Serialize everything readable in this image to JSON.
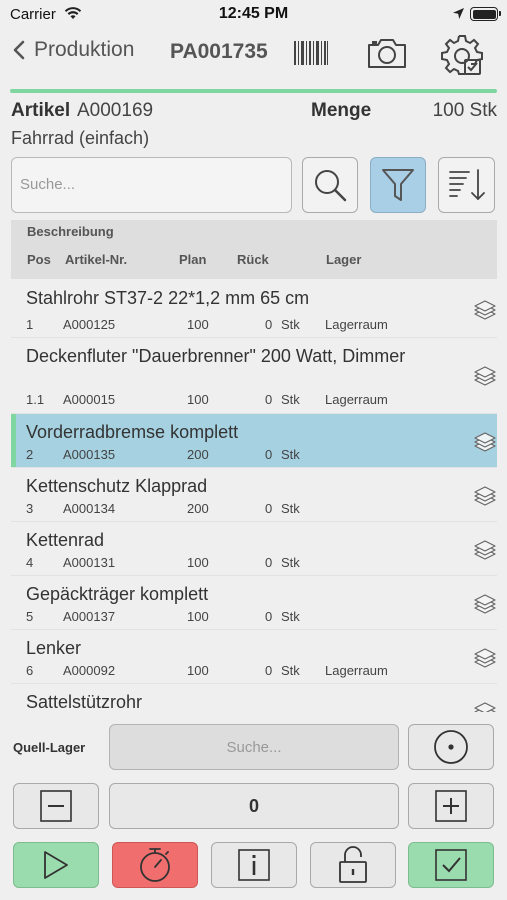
{
  "status": {
    "carrier": "Carrier",
    "time": "12:45 PM"
  },
  "nav": {
    "back_label": "Produktion",
    "title": "PA001735"
  },
  "article": {
    "label": "Artikel",
    "number": "A000169",
    "menge_label": "Menge",
    "menge_value": "100 Stk",
    "description": "Fahrrad (einfach)"
  },
  "search": {
    "placeholder": "Suche..."
  },
  "header": {
    "beschreibung": "Beschreibung",
    "pos": "Pos",
    "artikel_nr": "Artikel-Nr.",
    "plan": "Plan",
    "rueck": "Rück",
    "lager": "Lager"
  },
  "rows": [
    {
      "desc": "Stahlrohr ST37-2 22*1,2 mm 65 cm",
      "pos": "1",
      "artnr": "A000125",
      "plan": "100",
      "rueck": "0",
      "unit": "Stk",
      "lager": "Lagerraum"
    },
    {
      "desc": "Deckenfluter \"Dauerbrenner\" 200 Watt, Dimmer",
      "pos": "1.1",
      "artnr": "A000015",
      "plan": "100",
      "rueck": "0",
      "unit": "Stk",
      "lager": "Lagerraum"
    },
    {
      "desc": "Vorderradbremse komplett",
      "pos": "2",
      "artnr": "A000135",
      "plan": "200",
      "rueck": "0",
      "unit": "Stk",
      "lager": ""
    },
    {
      "desc": "Kettenschutz Klapprad",
      "pos": "3",
      "artnr": "A000134",
      "plan": "200",
      "rueck": "0",
      "unit": "Stk",
      "lager": ""
    },
    {
      "desc": "Kettenrad",
      "pos": "4",
      "artnr": "A000131",
      "plan": "100",
      "rueck": "0",
      "unit": "Stk",
      "lager": ""
    },
    {
      "desc": "Gepäckträger komplett",
      "pos": "5",
      "artnr": "A000137",
      "plan": "100",
      "rueck": "0",
      "unit": "Stk",
      "lager": ""
    },
    {
      "desc": "Lenker",
      "pos": "6",
      "artnr": "A000092",
      "plan": "100",
      "rueck": "0",
      "unit": "Stk",
      "lager": "Lagerraum"
    },
    {
      "desc": "Sattelstützrohr",
      "pos": "",
      "artnr": "",
      "plan": "",
      "rueck": "",
      "unit": "",
      "lager": ""
    }
  ],
  "selected_row": 2,
  "footer": {
    "quell_label": "Quell-Lager",
    "quell_placeholder": "Suche...",
    "quantity": "0"
  },
  "colors": {
    "accent_green": "#7fd6a0",
    "selected_blue": "#a6d1e1",
    "filter_active": "#a9cfe6",
    "stop_red": "#f06e6e",
    "confirm_green": "#9bdcae"
  },
  "icons": [
    "wifi-icon",
    "location-icon",
    "battery-icon",
    "back-chevron-icon",
    "barcode-icon",
    "camera-icon",
    "settings-gear-icon",
    "search-icon",
    "filter-icon",
    "sort-icon",
    "layers-icon",
    "target-icon",
    "minus-icon",
    "plus-icon",
    "play-icon",
    "stopwatch-icon",
    "info-icon",
    "unlock-icon",
    "checkbox-icon"
  ]
}
